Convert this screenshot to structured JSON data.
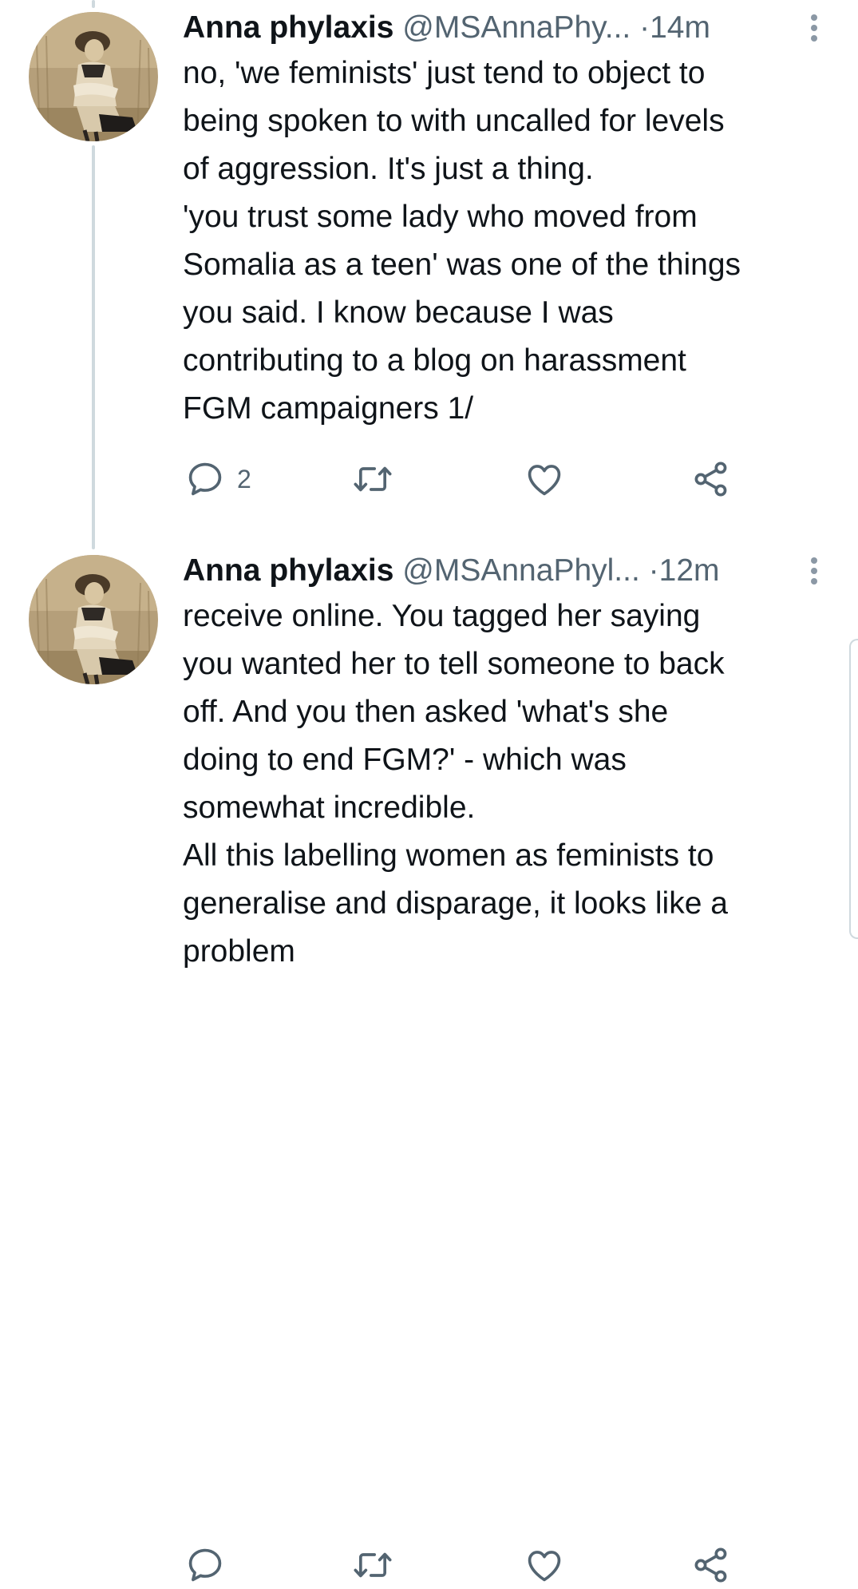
{
  "tweets": [
    {
      "name": "Anna phylaxis",
      "handle": "@MSAnnaPhy...",
      "separator": "·",
      "time": "14m",
      "lines": [
        "no, 'we feminists' just tend to object to",
        "being spoken to with uncalled for levels",
        "of aggression. It's just a thing.",
        "'you trust some lady who moved from",
        "Somalia as a teen' was one of the things",
        "you said. I know because I was",
        "contributing to a blog on harassment",
        "FGM campaigners 1/"
      ],
      "reply_count": "2",
      "avatar_icon": "vintage-photo-avatar"
    },
    {
      "name": "Anna phylaxis",
      "handle": "@MSAnnaPhyl...",
      "separator": "·",
      "time": "12m",
      "lines": [
        "receive online. You tagged her saying",
        "you wanted her to tell someone to back",
        "off. And you then asked 'what's she",
        "doing to end FGM?' - which was",
        "somewhat incredible.",
        "All this labelling women as feminists to",
        "generalise and disparage, it looks like a",
        "problem"
      ],
      "reply_count": "",
      "avatar_icon": "vintage-photo-avatar"
    }
  ],
  "icons": {
    "reply": "reply-icon",
    "retweet": "retweet-icon",
    "like": "heart-icon",
    "share": "share-icon",
    "more": "more-vertical-icon"
  },
  "colors": {
    "text_primary": "#0f1419",
    "text_secondary": "#536471",
    "thread_line": "#cfd9de"
  }
}
